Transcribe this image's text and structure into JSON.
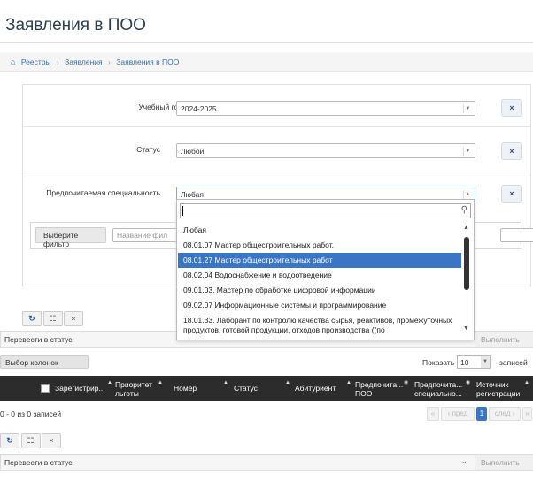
{
  "header": {
    "title": "Заявления в ПОО"
  },
  "breadcrumb": {
    "items": [
      "Реестры",
      "Заявления",
      "Заявления в ПОО"
    ]
  },
  "filters": {
    "year_label": "Учебный год",
    "year_value": "2024-2025",
    "status_label": "Статус",
    "status_value": "Любой",
    "specialty_label": "Предпочитаемая специальность",
    "specialty_value": "Любая",
    "choose_filter_label": "Выберите фильтр",
    "filter_name_placeholder": "Название фил",
    "clear_label": "×"
  },
  "dropdown": {
    "search_value": "",
    "options": [
      "Любая",
      "08.01.07 Мастер общестроительных работ.",
      "08.01.27 Мастер общестроительных работ",
      "08.02.04 Водоснабжение и водоотведение",
      "09.01.03. Мастер по обработке цифровой информации",
      "09.02.07 Информационные системы и программирование",
      "18.01.33. Лаборант по контролю качества сырья, реактивов, промежуточных продуктов, готовой продукции, отходов производства ((по"
    ],
    "selected_index": 2
  },
  "table_tools": {
    "refresh_icon": "↻",
    "columns_icon": "☷",
    "clear_icon": "×"
  },
  "actions": {
    "status_placeholder": "Перевести в статус",
    "execute_label": "Выполнить"
  },
  "table": {
    "columns_button": "Выбор колонок",
    "show_label": "Показать",
    "page_size": "10",
    "records_label": "записей",
    "headers": [
      "Зарегистрир...",
      "Приоритет льготы",
      "Номер",
      "Статус",
      "Абитуриент",
      "Предпочита... ПОО",
      "Предпочита... специально...",
      "Источник регистрации"
    ],
    "count_text": "0 - 0 из 0 записей"
  },
  "pager": {
    "first": "«",
    "prev": "‹ пред",
    "current": "1",
    "next": "след ›",
    "last": "»"
  },
  "colors": {
    "accent": "#3a76c4",
    "header_bg": "#2c2c2c",
    "link": "#3a6ea5",
    "clear_icon": "#2a4d8f"
  }
}
